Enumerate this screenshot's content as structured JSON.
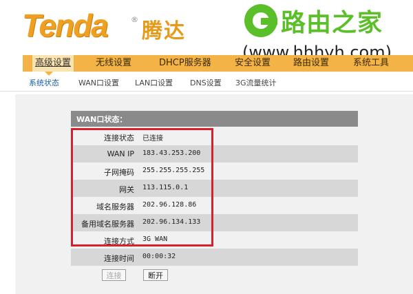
{
  "logo": {
    "brand": "Tenda",
    "reg": "®",
    "brand_cn": "腾达"
  },
  "watermark": {
    "title": "路由之家",
    "url": "(www.hhhyh.com)"
  },
  "nav": {
    "items": [
      {
        "label": "高级设置"
      },
      {
        "label": "无线设置"
      },
      {
        "label": "DHCP服务器"
      },
      {
        "label": "安全设置"
      },
      {
        "label": "路由设置"
      },
      {
        "label": "系统工具"
      }
    ]
  },
  "subnav": {
    "items": [
      {
        "label": "系统状态"
      },
      {
        "label": "WAN口设置"
      },
      {
        "label": "LAN口设置"
      },
      {
        "label": "DNS设置"
      },
      {
        "label": "3G流量统计"
      }
    ]
  },
  "wan": {
    "title": "WAN口状态：",
    "rows": [
      {
        "key": "连接状态",
        "value": "已连接"
      },
      {
        "key": "WAN IP",
        "value": "183.43.253.200"
      },
      {
        "key": "子网掩码",
        "value": "255.255.255.255"
      },
      {
        "key": "网关",
        "value": "113.115.0.1"
      },
      {
        "key": "域名服务器",
        "value": "202.96.128.86"
      },
      {
        "key": "备用域名服务器",
        "value": "202.96.134.133"
      },
      {
        "key": "连接方式",
        "value": "3G WAN"
      },
      {
        "key": "连接时间",
        "value": "00:00:32"
      }
    ]
  },
  "buttons": {
    "connect": "连接",
    "disconnect": "断开"
  },
  "colors": {
    "accent": "#f3b347",
    "highlight": "#d8202a",
    "watermark": "#5bbf2a"
  }
}
